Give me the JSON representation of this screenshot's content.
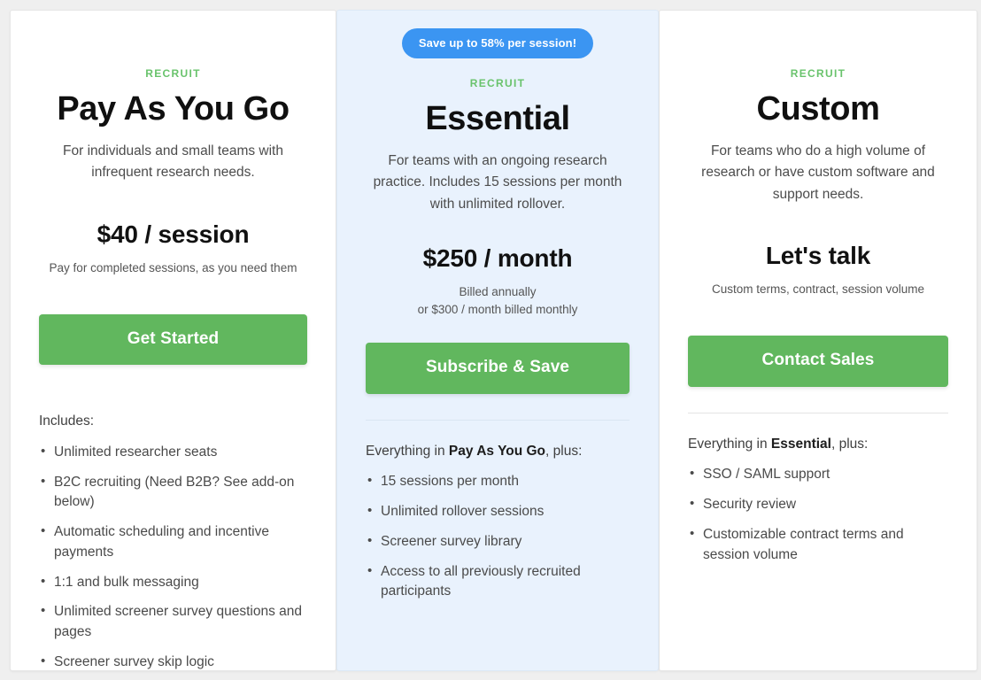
{
  "theme": {
    "page_background": "#efefef",
    "card_background": "#ffffff",
    "highlight_card_background": "#e9f2fd",
    "eyebrow_color": "#69c36c",
    "cta_color": "#61b75e",
    "badge_color": "#3b95f2"
  },
  "plans": [
    {
      "id": "pay-as-you-go",
      "badge": null,
      "eyebrow": "RECRUIT",
      "name": "Pay As You Go",
      "description": "For individuals and small teams with infrequent research needs.",
      "price": "$40 / session",
      "price_note_1": "Pay for completed sessions, as you need them",
      "price_note_2": "",
      "cta_label": "Get Started",
      "features_intro_prefix": "Includes:",
      "features_intro_bold": "",
      "features_intro_suffix": "",
      "features": [
        "Unlimited researcher seats",
        "B2C recruiting (Need B2B? See add-on below)",
        "Automatic scheduling and incentive payments",
        "1:1 and bulk messaging",
        "Unlimited screener survey questions and pages",
        "Screener survey skip logic"
      ]
    },
    {
      "id": "essential",
      "badge": "Save up to 58% per session!",
      "eyebrow": "RECRUIT",
      "name": "Essential",
      "description": "For teams with an ongoing research practice. Includes 15 sessions per month with unlimited rollover.",
      "price": "$250 / month",
      "price_note_1": "Billed annually",
      "price_note_2": "or $300 / month billed monthly",
      "cta_label": "Subscribe & Save",
      "features_intro_prefix": "Everything in ",
      "features_intro_bold": "Pay As You Go",
      "features_intro_suffix": ", plus:",
      "features": [
        "15 sessions per month",
        "Unlimited rollover sessions",
        "Screener survey library",
        "Access to all previously recruited participants"
      ]
    },
    {
      "id": "custom",
      "badge": null,
      "eyebrow": "RECRUIT",
      "name": "Custom",
      "description": "For teams who do a high volume of research or have custom software and support needs.",
      "price": "Let's talk",
      "price_note_1": "Custom terms, contract, session volume",
      "price_note_2": "",
      "cta_label": "Contact Sales",
      "features_intro_prefix": "Everything in ",
      "features_intro_bold": "Essential",
      "features_intro_suffix": ", plus:",
      "features": [
        "SSO / SAML support",
        "Security review",
        "Customizable contract terms and session volume"
      ]
    }
  ]
}
